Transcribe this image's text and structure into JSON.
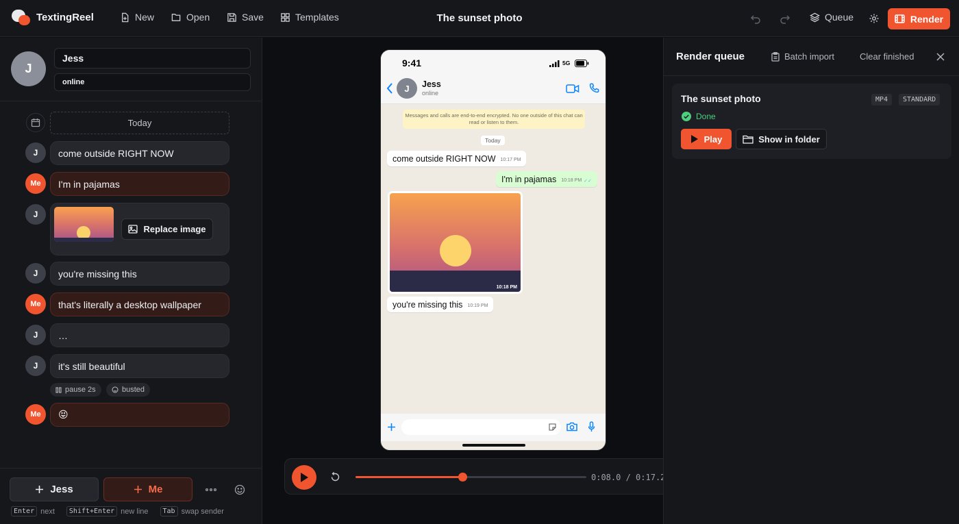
{
  "app": {
    "name": "TextingReel",
    "document_title": "The sunset photo"
  },
  "toolbar": {
    "new_label": "New",
    "open_label": "Open",
    "save_label": "Save",
    "templates_label": "Templates",
    "queue_label": "Queue",
    "render_label": "Render"
  },
  "contact": {
    "initial": "J",
    "name": "Jess",
    "status": "online"
  },
  "script": {
    "date_label": "Today",
    "messages": [
      {
        "sender": "J",
        "text": "come outside RIGHT NOW"
      },
      {
        "sender": "Me",
        "text": "I'm in pajamas"
      },
      {
        "sender": "J",
        "type": "image",
        "replace_label": "Replace image"
      },
      {
        "sender": "J",
        "text": "you're missing this"
      },
      {
        "sender": "Me",
        "text": "that's literally a desktop wallpaper"
      },
      {
        "sender": "J",
        "text": "…"
      },
      {
        "sender": "J",
        "text": "it's still beautiful"
      },
      {
        "sender": "Me",
        "text": "😝"
      }
    ],
    "chips": {
      "pause": "pause 2s",
      "reaction": "busted"
    }
  },
  "composer": {
    "add_jess": "Jess",
    "add_me": "Me",
    "hints": [
      {
        "key": "Enter",
        "label": "next"
      },
      {
        "key": "Shift+Enter",
        "label": "new line"
      },
      {
        "key": "Tab",
        "label": "swap sender"
      }
    ]
  },
  "phone": {
    "time": "9:41",
    "network": "5G",
    "contact_name": "Jess",
    "contact_status": "online",
    "encryption_notice": "Messages and calls are end-to-end encrypted. No one outside of this chat can read or listen to them.",
    "date_tag": "Today",
    "bubbles": [
      {
        "text": "come outside RIGHT NOW",
        "time": "10:17 PM"
      },
      {
        "text": "I'm in pajamas",
        "time": "10:18 PM"
      },
      {
        "image_time": "10:18 PM"
      },
      {
        "text": "you're missing this",
        "time": "10:19 PM"
      }
    ]
  },
  "player": {
    "current": "0:08.0",
    "total": "0:17.2",
    "progress": 0.465
  },
  "queue": {
    "title": "Render queue",
    "batch_import": "Batch import",
    "clear_finished": "Clear finished",
    "items": [
      {
        "title": "The sunset photo",
        "format": "MP4",
        "quality": "STANDARD",
        "status": "Done",
        "play_label": "Play",
        "folder_label": "Show in folder"
      }
    ]
  },
  "colors": {
    "accent": "#f0552f",
    "success": "#4cd07d",
    "whatsapp_out": "#d9fdd3",
    "ios_blue": "#0a84ff"
  }
}
